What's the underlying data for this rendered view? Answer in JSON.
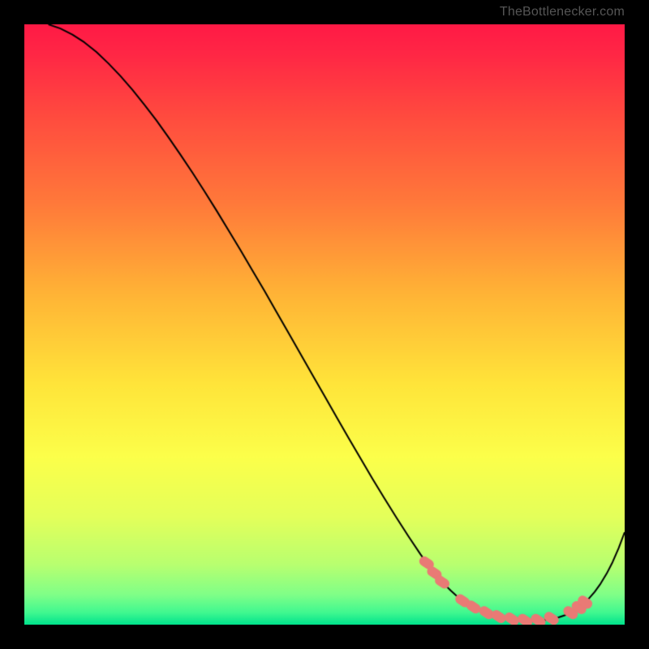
{
  "attribution": "TheBottlenecker.com",
  "chart_data": {
    "type": "line",
    "title": "",
    "xlabel": "",
    "ylabel": "",
    "xlim": [
      0,
      100
    ],
    "ylim": [
      0,
      100
    ],
    "background_gradient": [
      {
        "stop": 0.0,
        "color": "#ff1a45"
      },
      {
        "stop": 0.05,
        "color": "#ff2745"
      },
      {
        "stop": 0.15,
        "color": "#ff4a3f"
      },
      {
        "stop": 0.3,
        "color": "#ff7a3a"
      },
      {
        "stop": 0.45,
        "color": "#ffb436"
      },
      {
        "stop": 0.6,
        "color": "#ffe53a"
      },
      {
        "stop": 0.72,
        "color": "#fcff4a"
      },
      {
        "stop": 0.82,
        "color": "#e4ff5a"
      },
      {
        "stop": 0.9,
        "color": "#b8ff70"
      },
      {
        "stop": 0.95,
        "color": "#80ff88"
      },
      {
        "stop": 0.98,
        "color": "#40f890"
      },
      {
        "stop": 1.0,
        "color": "#00e28c"
      }
    ],
    "series": [
      {
        "name": "curve",
        "color": "#000000",
        "width": 2,
        "x": [
          4,
          6,
          8,
          10,
          12,
          14,
          16,
          18,
          20,
          22,
          24,
          26,
          28,
          30,
          32,
          34,
          36,
          38,
          40,
          42,
          44,
          46,
          48,
          50,
          52,
          54,
          56,
          58,
          60,
          62,
          64,
          66,
          67,
          68,
          69,
          70,
          71,
          72,
          73,
          74,
          75,
          76,
          77,
          78,
          79,
          80,
          81,
          82,
          83,
          84,
          85,
          86,
          87,
          88,
          89,
          90,
          91,
          92,
          93,
          94,
          95,
          96,
          97,
          98,
          99,
          100
        ],
        "y": [
          100,
          99.3,
          98.3,
          97.0,
          95.4,
          93.5,
          91.4,
          89.1,
          86.6,
          84.0,
          81.2,
          78.3,
          75.3,
          72.2,
          69.0,
          65.7,
          62.4,
          59.0,
          55.6,
          52.1,
          48.6,
          45.1,
          41.6,
          38.1,
          34.6,
          31.1,
          27.7,
          24.3,
          21.0,
          17.8,
          14.7,
          11.7,
          10.3,
          9.0,
          7.8,
          6.7,
          5.7,
          4.8,
          4.0,
          3.3,
          2.7,
          2.2,
          1.8,
          1.5,
          1.25,
          1.05,
          0.9,
          0.8,
          0.72,
          0.68,
          0.68,
          0.72,
          0.82,
          0.98,
          1.22,
          1.55,
          2.0,
          2.6,
          3.35,
          4.3,
          5.45,
          6.85,
          8.5,
          10.45,
          12.75,
          15.4
        ]
      }
    ],
    "markers": [
      {
        "name": "obstruction-dots",
        "color": "#e97a75",
        "radius": 6,
        "cap": "round",
        "points": [
          {
            "x": 67.0,
            "y": 10.3
          },
          {
            "x": 68.3,
            "y": 8.6
          },
          {
            "x": 69.6,
            "y": 7.1
          },
          {
            "x": 73.0,
            "y": 4.0
          },
          {
            "x": 74.8,
            "y": 2.95
          },
          {
            "x": 77.0,
            "y": 2.0
          },
          {
            "x": 79.0,
            "y": 1.35
          },
          {
            "x": 81.2,
            "y": 0.95
          },
          {
            "x": 83.4,
            "y": 0.72
          },
          {
            "x": 85.6,
            "y": 0.72
          },
          {
            "x": 87.8,
            "y": 1.05
          },
          {
            "x": 91.0,
            "y": 2.0
          },
          {
            "x": 92.4,
            "y": 2.85
          },
          {
            "x": 93.4,
            "y": 3.75
          }
        ]
      }
    ]
  }
}
